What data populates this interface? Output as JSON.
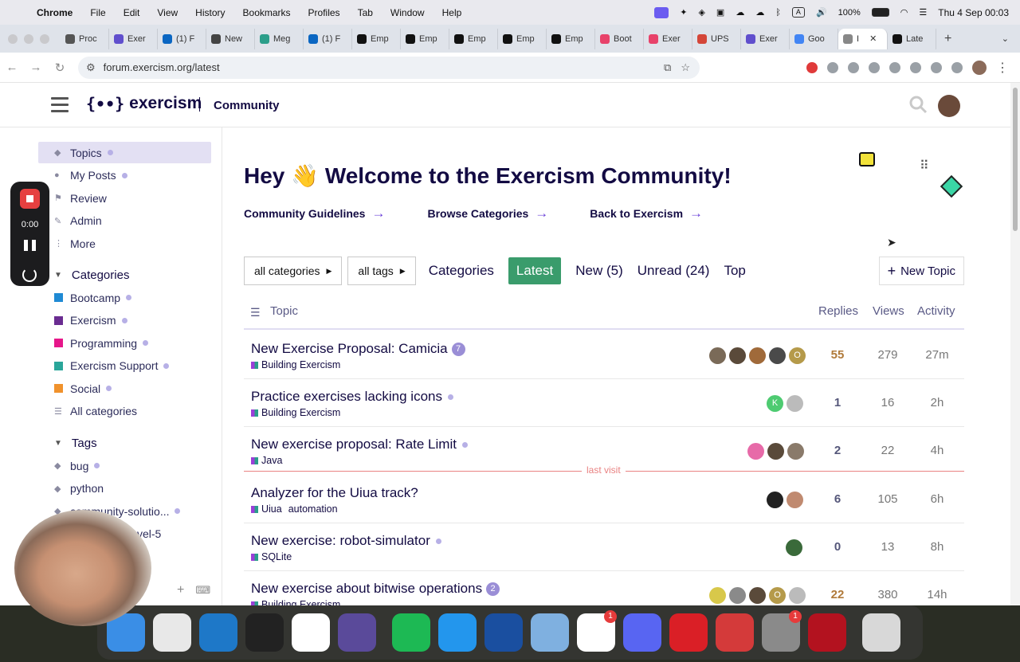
{
  "mac_menu": {
    "app": "Chrome",
    "items": [
      "File",
      "Edit",
      "View",
      "History",
      "Bookmarks",
      "Profiles",
      "Tab",
      "Window",
      "Help"
    ],
    "battery": "100%",
    "clock": "Thu 4 Sep  00:03"
  },
  "tabs": [
    {
      "label": "Proc",
      "color": "#555"
    },
    {
      "label": "Exer",
      "color": "#604fcd"
    },
    {
      "label": "(1) F",
      "color": "#0a66c2"
    },
    {
      "label": "New",
      "color": "#444"
    },
    {
      "label": "Meg",
      "color": "#2b9e8a"
    },
    {
      "label": "(1) F",
      "color": "#0a66c2"
    },
    {
      "label": "Emp",
      "color": "#111"
    },
    {
      "label": "Emp",
      "color": "#111"
    },
    {
      "label": "Emp",
      "color": "#111"
    },
    {
      "label": "Emp",
      "color": "#111"
    },
    {
      "label": "Emp",
      "color": "#111"
    },
    {
      "label": "Boot",
      "color": "#e8426a"
    },
    {
      "label": "Exer",
      "color": "#e8426a"
    },
    {
      "label": "UPS",
      "color": "#d44638"
    },
    {
      "label": "Exer",
      "color": "#604fcd"
    },
    {
      "label": "Goo",
      "color": "#4285f4"
    },
    {
      "label": "I",
      "color": "#888"
    },
    {
      "label": "Late",
      "color": "#111"
    }
  ],
  "address": {
    "url": "forum.exercism.org/latest"
  },
  "header": {
    "logo": "exercism",
    "logo_brace": "{∙∙}",
    "section": "Community"
  },
  "sidebar": {
    "main": [
      {
        "label": "Topics",
        "icon": "layers-icon",
        "dot": true
      },
      {
        "label": "My Posts",
        "icon": "user-icon",
        "dot": true
      },
      {
        "label": "Review",
        "icon": "flag-icon",
        "dot": false
      },
      {
        "label": "Admin",
        "icon": "wrench-icon",
        "dot": false
      },
      {
        "label": "More",
        "icon": "more-vertical-icon",
        "dot": false
      }
    ],
    "categories_heading": "Categories",
    "categories": [
      {
        "label": "Bootcamp",
        "color": "#1f8ad4",
        "dot": true
      },
      {
        "label": "Exercism",
        "color": "#6a2c91",
        "dot": true
      },
      {
        "label": "Programming",
        "color": "#e6178a",
        "dot": true
      },
      {
        "label": "Exercism Support",
        "color": "#2aa69a",
        "dot": true
      },
      {
        "label": "Social",
        "color": "#f0922c",
        "dot": true
      },
      {
        "label": "All categories",
        "color": "",
        "dot": false
      }
    ],
    "tags_heading": "Tags",
    "tags": [
      {
        "label": "bug",
        "dot": true
      },
      {
        "label": "python",
        "dot": false
      },
      {
        "label": "community-solutio...",
        "dot": true
      },
      {
        "label": "vel-5",
        "dot": false
      }
    ]
  },
  "welcome": {
    "hey": "Hey",
    "wave": "👋",
    "title": "Welcome to the Exercism Community!"
  },
  "quick_links": [
    {
      "label": "Community Guidelines",
      "arrow": "→"
    },
    {
      "label": "Browse Categories",
      "arrow": "→"
    },
    {
      "label": "Back to Exercism",
      "arrow": "→"
    }
  ],
  "filters": {
    "all_categories": "all categories",
    "all_tags": "all tags"
  },
  "nav_tabs": [
    "Categories",
    "Latest",
    "New (5)",
    "Unread (24)",
    "Top"
  ],
  "new_topic": "New Topic",
  "table_head": {
    "topic": "Topic",
    "replies": "Replies",
    "views": "Views",
    "activity": "Activity"
  },
  "last_visit": "last visit",
  "topics": [
    {
      "title": "New Exercise Proposal: Camicia",
      "badge": "7",
      "dot": false,
      "category": "Building Exercism",
      "tag": "",
      "posters": [
        "#7a6a58",
        "#5a4a3a",
        "#a06a3a",
        "#4a4a4a",
        "#b59a4a"
      ],
      "poster_text": [
        "",
        "",
        "",
        "",
        "O"
      ],
      "replies": "55",
      "views": "279",
      "activity": "27m",
      "hot": true
    },
    {
      "title": "Practice exercises lacking icons",
      "badge": "",
      "dot": true,
      "category": "Building Exercism",
      "tag": "",
      "posters": [
        "#4ecb71",
        "#bbbbbb"
      ],
      "poster_text": [
        "K",
        ""
      ],
      "replies": "1",
      "views": "16",
      "activity": "2h",
      "hot": false
    },
    {
      "title": "New exercise proposal: Rate Limit",
      "badge": "",
      "dot": true,
      "category": "Java",
      "tag": "",
      "posters": [
        "#e76aa8",
        "#5a4a3a",
        "#8a7a6a"
      ],
      "poster_text": [
        "",
        "",
        ""
      ],
      "replies": "2",
      "views": "22",
      "activity": "4h",
      "hot": false
    },
    {
      "title": "Analyzer for the Uiua track?",
      "badge": "",
      "dot": false,
      "category": "Uiua",
      "tag": "automation",
      "posters": [
        "#222222",
        "#c08a70"
      ],
      "poster_text": [
        "",
        ""
      ],
      "replies": "6",
      "views": "105",
      "activity": "6h",
      "hot": false
    },
    {
      "title": "New exercise: robot-simulator",
      "badge": "",
      "dot": true,
      "category": "SQLite",
      "tag": "",
      "posters": [
        "#3a6a3a"
      ],
      "poster_text": [
        ""
      ],
      "replies": "0",
      "views": "13",
      "activity": "8h",
      "hot": false
    },
    {
      "title": "New exercise about bitwise operations",
      "badge": "2",
      "dot": false,
      "category": "Building Exercism",
      "tag": "",
      "posters": [
        "#d8c84a",
        "#8a8a8a",
        "#5a4a3a",
        "#b59a4a",
        "#bbbbbb"
      ],
      "poster_text": [
        "",
        "",
        "",
        "O",
        ""
      ],
      "replies": "22",
      "views": "380",
      "activity": "14h",
      "hot": true
    }
  ],
  "recorder": {
    "time": "0:00"
  },
  "dock": [
    {
      "name": "finder",
      "color": "#3a8ee6",
      "badge": ""
    },
    {
      "name": "chrome",
      "color": "#e8e8e8",
      "badge": ""
    },
    {
      "name": "vscode",
      "color": "#1e78c8",
      "badge": ""
    },
    {
      "name": "terminal",
      "color": "#222222",
      "badge": ""
    },
    {
      "name": "notion",
      "color": "#ffffff",
      "badge": ""
    },
    {
      "name": "proxyman",
      "color": "#5a4a9a",
      "badge": ""
    },
    {
      "name": "spotify",
      "color": "#1db954",
      "badge": ""
    },
    {
      "name": "docker",
      "color": "#2396ed",
      "badge": ""
    },
    {
      "name": "1password",
      "color": "#1a4fa0",
      "badge": ""
    },
    {
      "name": "preview",
      "color": "#7fb0e0",
      "badge": ""
    },
    {
      "name": "slack",
      "color": "#ffffff",
      "badge": "1"
    },
    {
      "name": "discord",
      "color": "#5865f2",
      "badge": ""
    },
    {
      "name": "creative-cloud",
      "color": "#da1f26",
      "badge": ""
    },
    {
      "name": "safari-dev",
      "color": "#d43a3a",
      "badge": ""
    },
    {
      "name": "system-settings",
      "color": "#8a8a8a",
      "badge": "1"
    },
    {
      "name": "acrobat",
      "color": "#b3121f",
      "badge": ""
    },
    {
      "name": "trash",
      "color": "#d8d8d8",
      "badge": ""
    }
  ]
}
